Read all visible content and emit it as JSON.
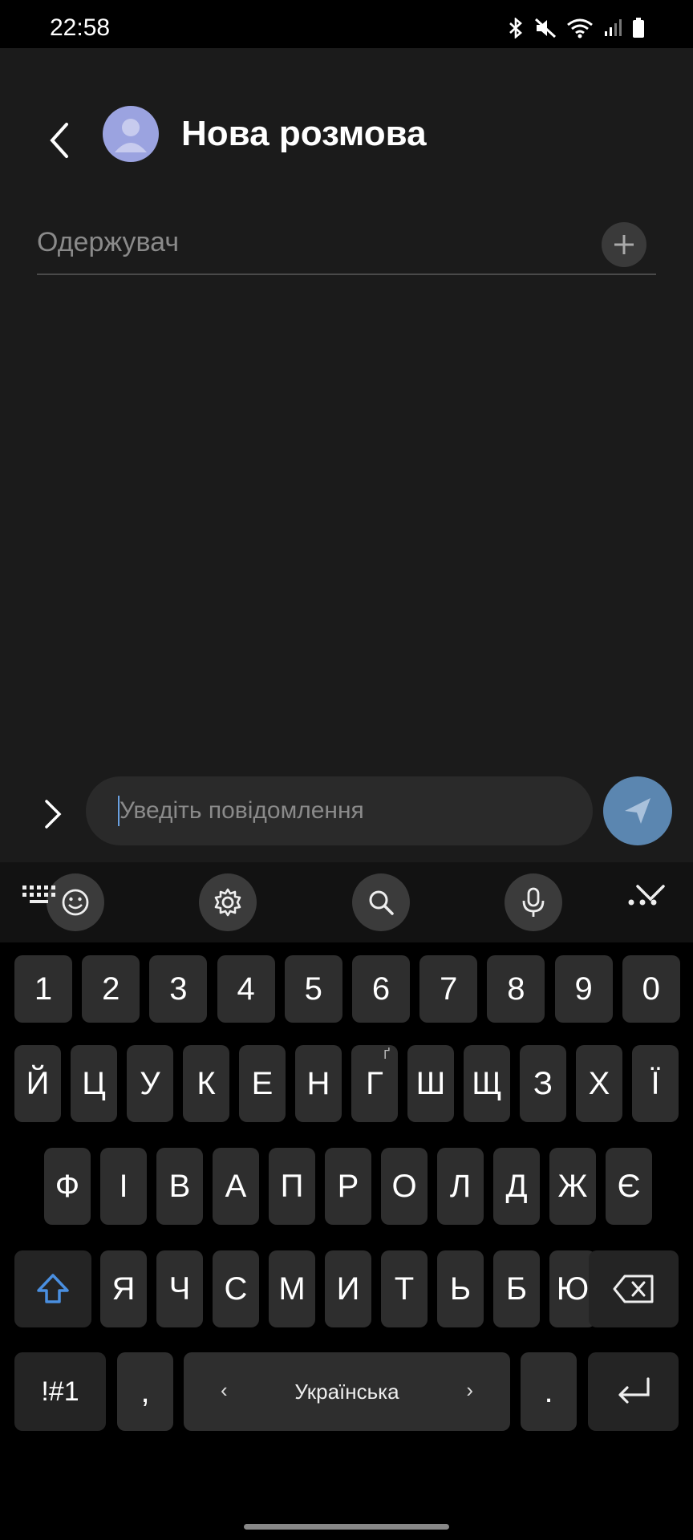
{
  "status_bar": {
    "time": "22:58"
  },
  "header": {
    "title": "Нова розмова"
  },
  "recipient": {
    "placeholder": "Одержувач"
  },
  "compose": {
    "placeholder": "Уведіть повідомлення"
  },
  "keyboard": {
    "number_row": [
      "1",
      "2",
      "3",
      "4",
      "5",
      "6",
      "7",
      "8",
      "9",
      "0"
    ],
    "row1": [
      "Й",
      "Ц",
      "У",
      "К",
      "Е",
      "Н",
      "Г",
      "Ш",
      "Щ",
      "З",
      "Х",
      "Ї"
    ],
    "row1_alt_on_g": "Ґ",
    "row2": [
      "Ф",
      "І",
      "В",
      "А",
      "П",
      "Р",
      "О",
      "Л",
      "Д",
      "Ж",
      "Є"
    ],
    "row3": [
      "Я",
      "Ч",
      "С",
      "М",
      "И",
      "Т",
      "Ь",
      "Б",
      "Ю"
    ],
    "symbols_label": "!#1",
    "comma_label": ",",
    "space_label": "Українська",
    "period_label": "."
  },
  "colors": {
    "accent_send": "#5b86b0",
    "shift_blue": "#4a8fe0",
    "avatar": "#9ba3e0"
  }
}
